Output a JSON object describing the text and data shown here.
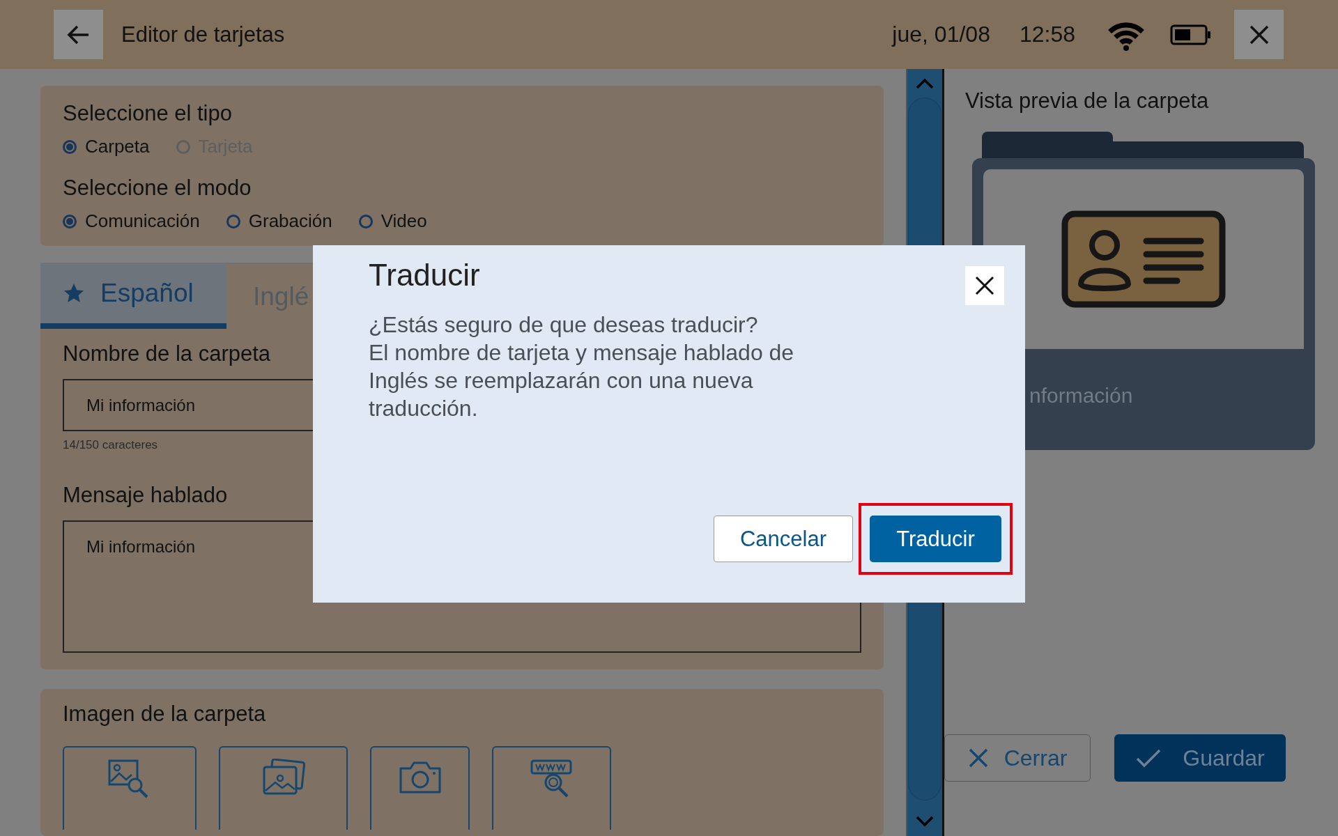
{
  "header": {
    "title": "Editor de tarjetas",
    "date": "jue, 01/08",
    "time": "12:58"
  },
  "type_section": {
    "title": "Seleccione el tipo",
    "options": [
      {
        "label": "Carpeta",
        "selected": true,
        "disabled": false
      },
      {
        "label": "Tarjeta",
        "selected": false,
        "disabled": true
      }
    ]
  },
  "mode_section": {
    "title": "Seleccione el modo",
    "options": [
      {
        "label": "Comunicación",
        "selected": true,
        "disabled": false
      },
      {
        "label": "Grabación",
        "selected": false,
        "disabled": false
      },
      {
        "label": "Video",
        "selected": false,
        "disabled": false
      }
    ]
  },
  "language_tabs": [
    {
      "label": "Español",
      "selected": true,
      "starred": true
    },
    {
      "label": "Inglé",
      "selected": false,
      "starred": false
    }
  ],
  "name_field": {
    "label": "Nombre de la carpeta",
    "value": "Mi información",
    "counter": "14/150 caracteres"
  },
  "message_field": {
    "label": "Mensaje hablado",
    "value": "Mi información"
  },
  "image_section": {
    "title": "Imagen de la carpeta",
    "sources": [
      {
        "kind": "image-search"
      },
      {
        "kind": "photos"
      },
      {
        "kind": "camera"
      },
      {
        "kind": "web-search"
      }
    ]
  },
  "preview": {
    "title": "Vista previa de la carpeta",
    "label": "nformación"
  },
  "footer": {
    "close": "Cerrar",
    "save": "Guardar"
  },
  "dialog": {
    "title": "Traducir",
    "message": "¿Estás seguro de que deseas traducir?\nEl nombre de tarjeta y mensaje hablado de\nInglés se reemplazarán con una nueva\ntraducción.",
    "cancel": "Cancelar",
    "confirm": "Traducir",
    "confirm_highlighted": true
  }
}
